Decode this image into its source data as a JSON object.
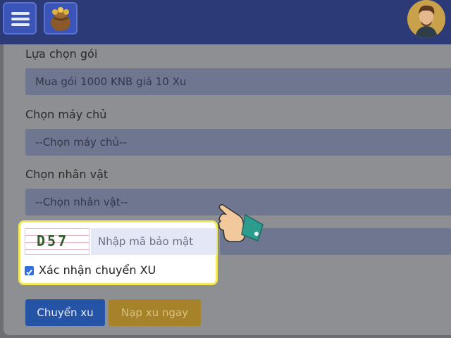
{
  "header": {
    "menu_icon": "hamburger-menu-icon",
    "bag_icon": "coin-bag-icon",
    "avatar_icon": "user-avatar"
  },
  "form": {
    "package_label": "Lựa chọn gói",
    "package_value": "Mua gói 1000 KNB giá 10 Xu",
    "server_label": "Chọn máy chủ",
    "server_value": "--Chọn máy chủ--",
    "character_label": "Chọn nhân vật",
    "character_value": "--Chọn nhân vật--",
    "captcha_code": "D57",
    "captcha_placeholder": "Nhập mã bảo mật",
    "confirm_label": "Xác nhận chuyển XU",
    "confirm_checked": true
  },
  "buttons": {
    "transfer": "Chuyển xu",
    "topup": "Nạp xu ngay"
  },
  "colors": {
    "topbar": "#2c3a78",
    "highlight_border": "#f1ea5a",
    "primary_button": "#2553a6",
    "warning_button": "#a6832a"
  }
}
